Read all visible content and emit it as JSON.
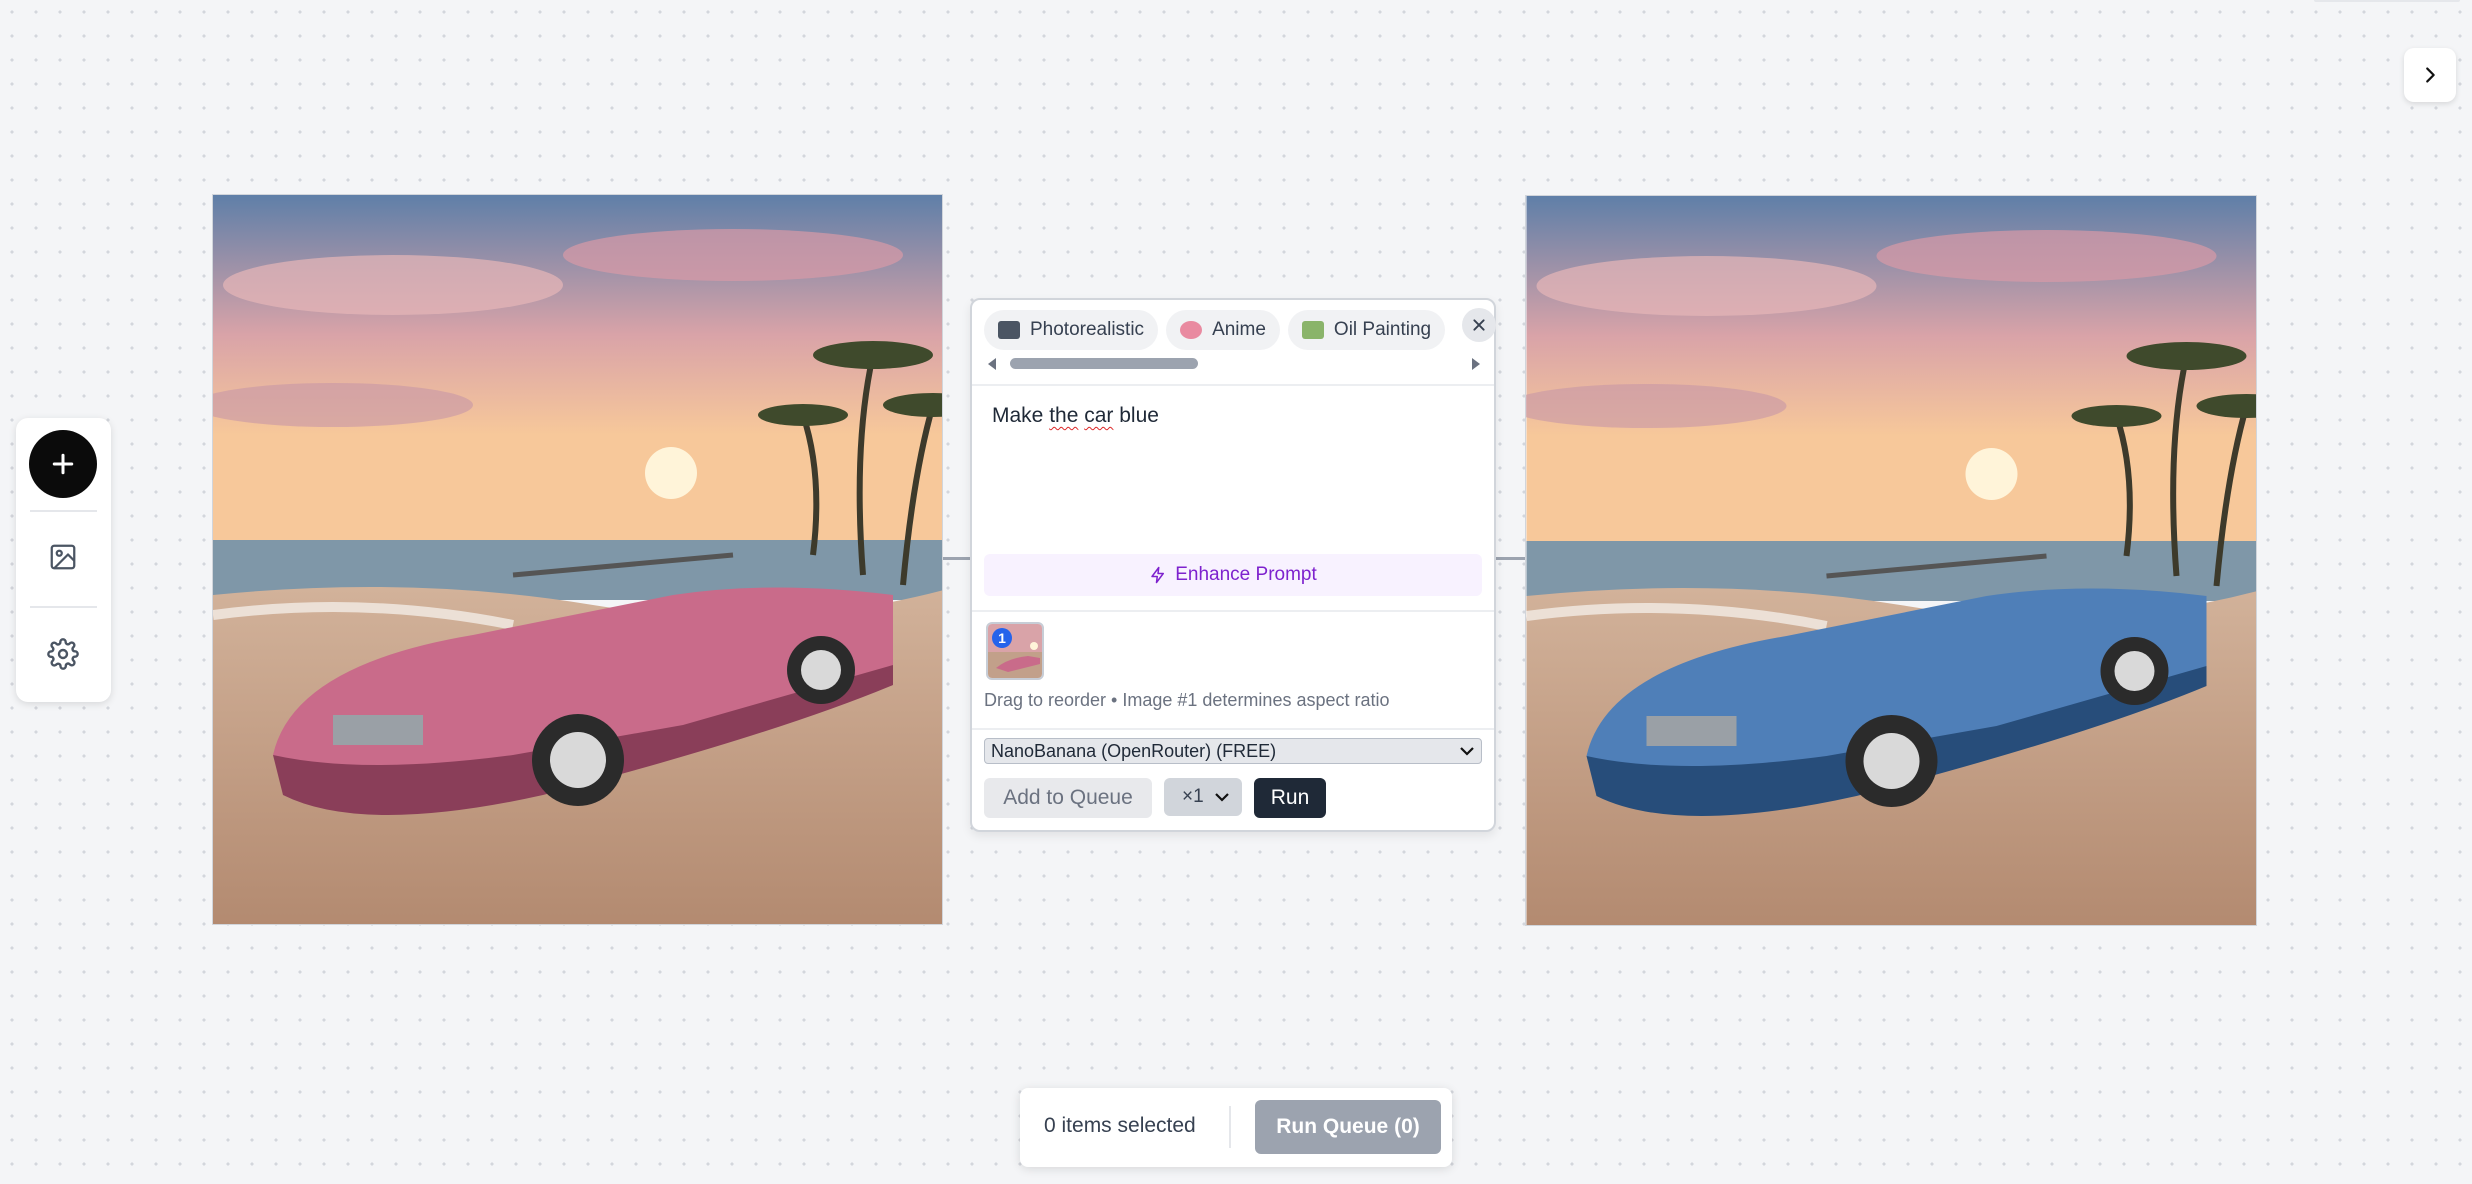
{
  "app": {
    "top_tab": ""
  },
  "toolbar": {
    "add_icon": "plus-icon",
    "image_icon": "image-icon",
    "settings_icon": "gear-icon"
  },
  "images": {
    "source": {
      "description_icon": "source-image",
      "car_color": "#c96b8a"
    },
    "result": {
      "description_icon": "result-image",
      "car_color": "#4f7fb8"
    }
  },
  "node": {
    "styles": [
      {
        "label": "Photorealistic",
        "icon": "camera-icon",
        "icon_color": "#4b5563"
      },
      {
        "label": "Anime",
        "icon": "palette-icon",
        "icon_color": "#e98aa0"
      },
      {
        "label": "Oil Painting",
        "icon": "framed-picture-icon",
        "icon_color": "#8ab46a"
      }
    ],
    "prompt": {
      "w1": "Make ",
      "w2": "the",
      "w3": " ",
      "w4": "car",
      "w5": " blue"
    },
    "enhance_label": "Enhance Prompt",
    "ref_index": "1",
    "hint": "Drag to reorder • Image #1 determines aspect ratio",
    "model": "NanoBanana (OpenRouter) (FREE)",
    "add_to_queue": "Add to Queue",
    "multiplier": "×1",
    "run": "Run"
  },
  "bottom": {
    "selected": "0 items selected",
    "run_queue": "Run Queue (0)"
  },
  "colors": {
    "accent_purple": "#7e22ce",
    "dark": "#1f2937",
    "badge_blue": "#2563eb"
  }
}
